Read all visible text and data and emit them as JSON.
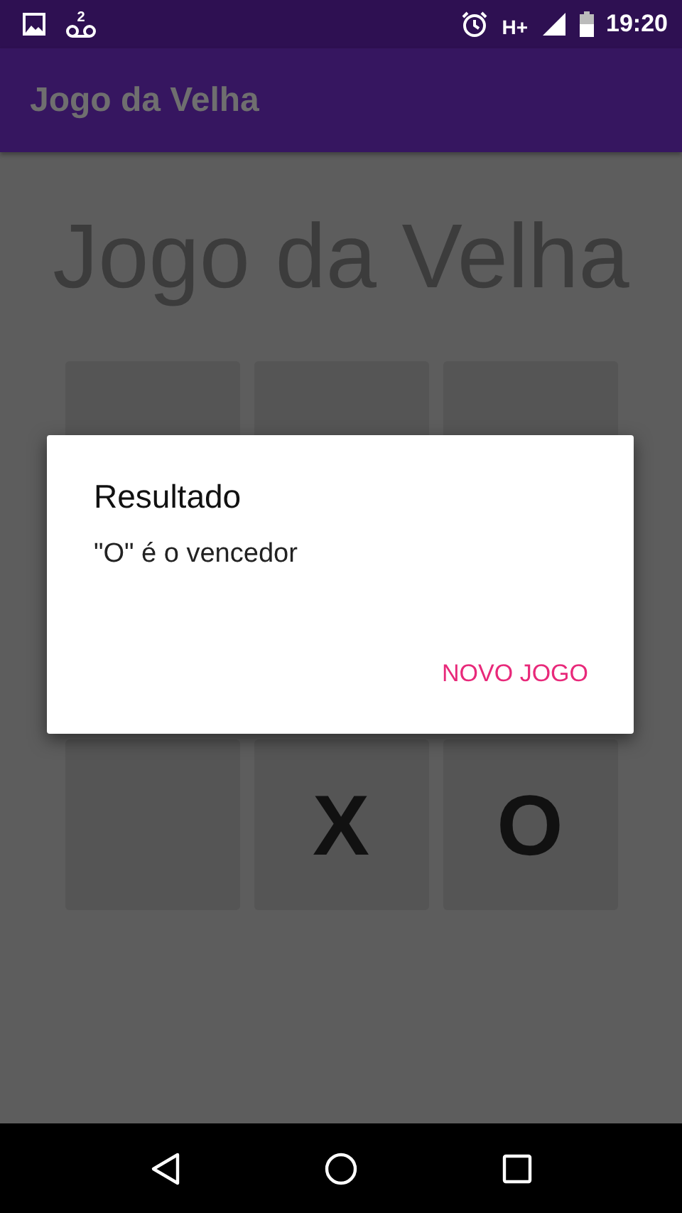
{
  "status_bar": {
    "voicemail_count": "2",
    "network": "H+",
    "time": "19:20"
  },
  "app_bar": {
    "title": "Jogo da Velha"
  },
  "heading": "Jogo da Velha",
  "board": {
    "rows": [
      [
        {},
        {},
        {}
      ],
      [
        {},
        {
          "mark": "X"
        },
        {
          "mark": "O"
        }
      ]
    ]
  },
  "dialog": {
    "title": "Resultado",
    "message": "\"O\" é o vencedor",
    "buttons": [
      "NOVO JOGO"
    ]
  }
}
